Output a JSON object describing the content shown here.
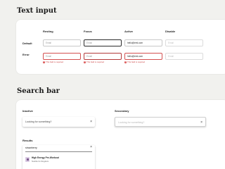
{
  "text_input": {
    "title": "Text input",
    "columns": [
      "Resting",
      "Focus",
      "Active",
      "Disable"
    ],
    "rows": [
      {
        "label": "Default",
        "values": [
          "Email",
          "Email",
          "hello@eml.com",
          "Email"
        ],
        "error": ""
      },
      {
        "label": "Error",
        "values": [
          "Email",
          "Email",
          "hello@eml.com",
          "Email"
        ],
        "error": "This field is required"
      }
    ]
  },
  "search_bar": {
    "title": "Search bar",
    "inactive": {
      "label": "Inactive",
      "placeholder": "Looking for something?",
      "clear": "×"
    },
    "secondary": {
      "label": "Secondary",
      "placeholder": "Looking for something?",
      "clear": "×"
    },
    "results": {
      "label": "Results",
      "query": "strawberry",
      "clear": "×",
      "items": [
        {
          "title": "High Energy Pre-Workout",
          "subtitle": "Nutrition's Kingdom"
        }
      ]
    }
  },
  "colors": {
    "background": "#f1f1ee",
    "card": "#ffffff",
    "error": "#d35050"
  }
}
